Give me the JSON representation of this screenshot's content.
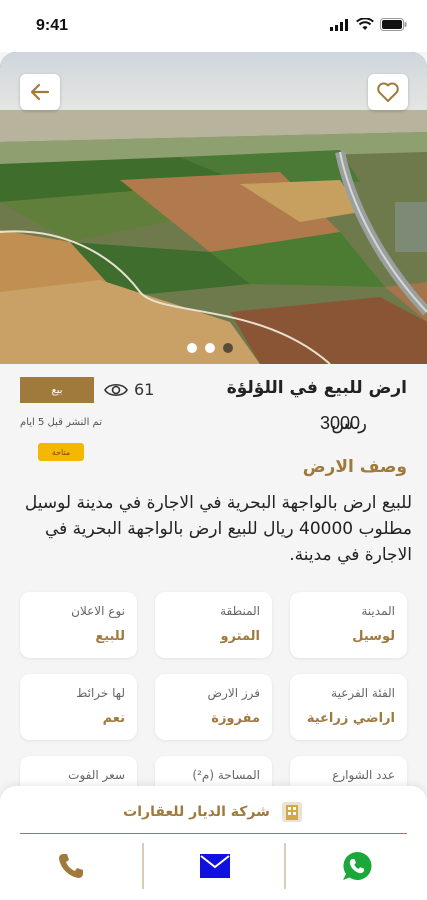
{
  "status": {
    "time": "9:41"
  },
  "listing": {
    "title": "ارض للبيع في اللؤلؤة",
    "price_currency": "ر.س",
    "price_value": "3000",
    "type_badge": "بيع",
    "views": "61",
    "posted": "تم النشر قبل 5 ايام",
    "status_pill": "متاحة",
    "image_count": 3,
    "active_image": 3
  },
  "description": {
    "title": "وصف الارض",
    "text": "للبيع ارض بالواجهة البحرية في الاجارة في مدينة لوسيل مطلوب 40000 ريال للبيع ارض بالواجهة البحرية في الاجارة في مدينة."
  },
  "details": [
    {
      "label": "المدينة",
      "value": "لوسيل"
    },
    {
      "label": "المنطقة",
      "value": "المترو"
    },
    {
      "label": "نوع الاعلان",
      "value": "للبيع"
    },
    {
      "label": "الفئة الفرعية",
      "value": "اراضي زراعية"
    },
    {
      "label": "فرز الارض",
      "value": "مفروزة"
    },
    {
      "label": "لها خرائط",
      "value": "نعم"
    },
    {
      "label": "عدد الشوارع",
      "value": ""
    },
    {
      "label": "المساحة (م²)",
      "value": ""
    },
    {
      "label": "سعر الفوت",
      "value": ""
    }
  ],
  "company": {
    "name": "شركة الديار للعقارات"
  },
  "colors": {
    "brand": "#a07a3c",
    "pill": "#f5b800",
    "mail": "#1010e0",
    "whatsapp": "#1aa83a"
  }
}
